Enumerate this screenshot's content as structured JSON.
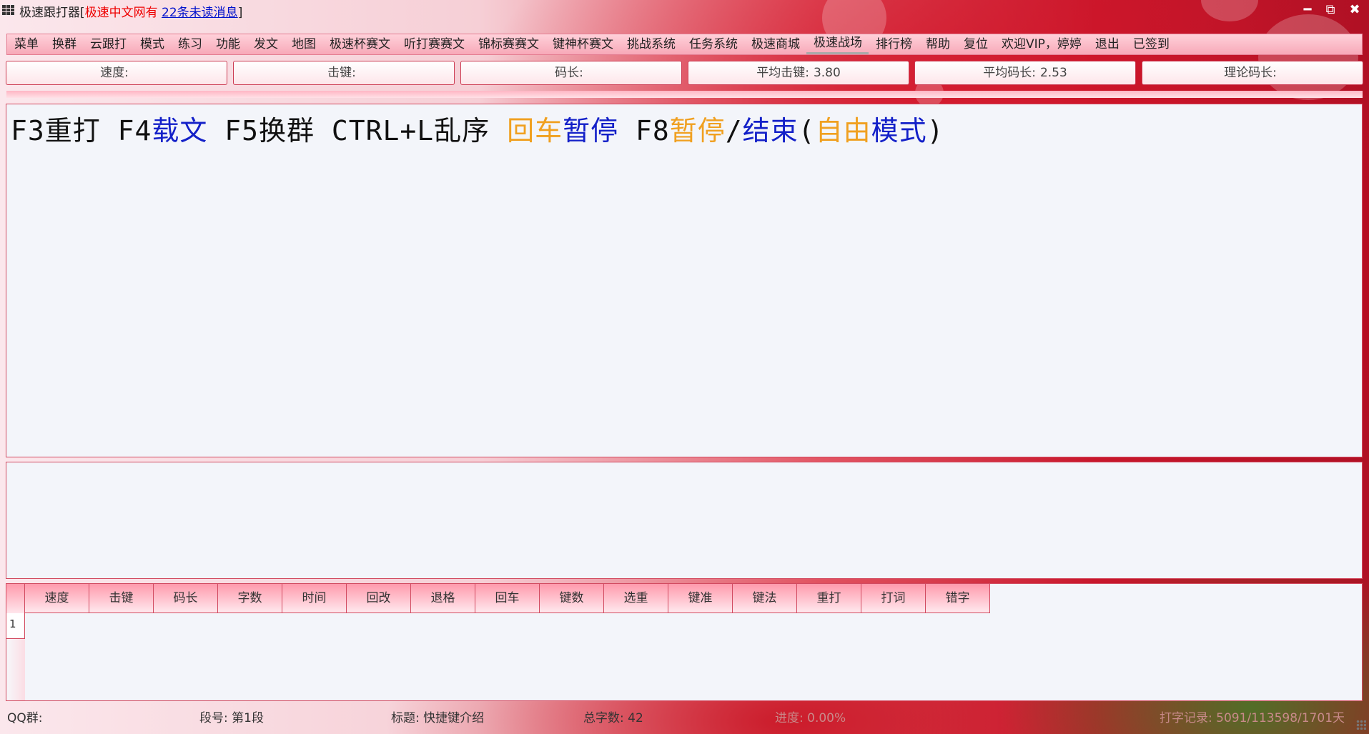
{
  "window": {
    "app_name": "极速跟打器",
    "title_bracket_open": "[",
    "site_name": "极速中文网有",
    "unread_link": "22条未读消息",
    "title_bracket_close": "]",
    "minimize_glyph": "━",
    "restore_glyph": "⧉",
    "close_glyph": "✖"
  },
  "menu": {
    "items": [
      "菜单",
      "换群",
      "云跟打",
      "模式",
      "练习",
      "功能",
      "发文",
      "地图",
      "极速杯赛文",
      "听打赛赛文",
      "锦标赛赛文",
      "键神杯赛文",
      "挑战系统",
      "任务系统",
      "极速商城",
      "极速战场",
      "排行榜",
      "帮助",
      "复位",
      "欢迎VIP，婷婷",
      "退出",
      "已签到"
    ],
    "active_index": 15
  },
  "stats": [
    {
      "label": "速度:",
      "value": ""
    },
    {
      "label": "击键:",
      "value": ""
    },
    {
      "label": "码长:",
      "value": ""
    },
    {
      "label": "平均击键:",
      "value": "3.80"
    },
    {
      "label": "平均码长:",
      "value": "2.53"
    },
    {
      "label": "理论码长:",
      "value": ""
    }
  ],
  "text_area": {
    "segments": [
      {
        "text": "F3重打 F4",
        "color": "black"
      },
      {
        "text": "载文",
        "color": "blue"
      },
      {
        "text": " F5换群 CTRL+L乱序 ",
        "color": "black"
      },
      {
        "text": "回车",
        "color": "orange"
      },
      {
        "text": "暂停",
        "color": "blue"
      },
      {
        "text": " F8",
        "color": "black"
      },
      {
        "text": "暂停",
        "color": "orange"
      },
      {
        "text": "/",
        "color": "black"
      },
      {
        "text": "结束",
        "color": "blue"
      },
      {
        "text": "(",
        "color": "black"
      },
      {
        "text": "自由",
        "color": "orange"
      },
      {
        "text": "模式",
        "color": "blue"
      },
      {
        "text": ")",
        "color": "black"
      }
    ]
  },
  "results_table": {
    "columns": [
      "速度",
      "击键",
      "码长",
      "字数",
      "时间",
      "回改",
      "退格",
      "回车",
      "键数",
      "选重",
      "键准",
      "键法",
      "重打",
      "打词",
      "错字"
    ],
    "row_numbers": [
      "1"
    ]
  },
  "status_bar": {
    "qq_group": "QQ群:",
    "segment": "段号: 第1段",
    "title": "标题: 快捷键介绍",
    "total_chars": "总字数: 42",
    "progress": "进度: 0.00%",
    "typing_record": "打字记录: 5091/113598/1701天"
  },
  "colors": {
    "accent_border": "#d24a60",
    "blue_text": "#1320c8",
    "orange_text": "#f0a020",
    "title_red": "#ee0000",
    "link_blue": "#0011cc"
  }
}
